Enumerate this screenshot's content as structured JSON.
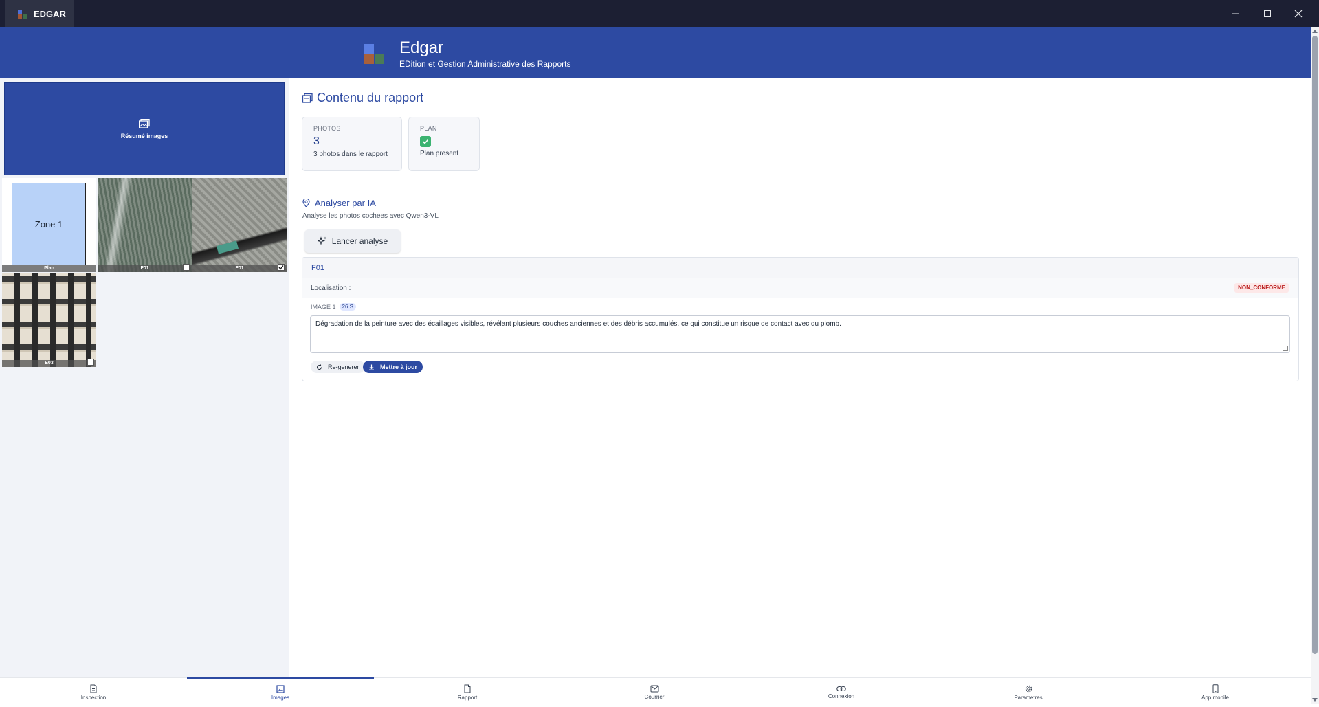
{
  "window": {
    "tab_title": "EDGAR",
    "controls": [
      "minimize-icon",
      "maximize-icon",
      "close-icon"
    ]
  },
  "header": {
    "title": "Edgar",
    "subtitle": "EDition et Gestion Administrative des Rapports",
    "brand_color": "#2d4aa2"
  },
  "left_panel": {
    "summary_button": "Résumé images",
    "thumbnails": [
      {
        "caption": "Plan",
        "kind": "plan",
        "zone_label": "Zone 1"
      },
      {
        "caption": "F01",
        "kind": "photo",
        "checked": false
      },
      {
        "caption": "F01",
        "kind": "photo",
        "checked": true
      },
      {
        "caption": "E03",
        "kind": "photo",
        "checked": false
      }
    ]
  },
  "report": {
    "title": "Contenu du rapport",
    "photos": {
      "label": "PHOTOS",
      "value": "3",
      "sub": "3 photos dans le rapport"
    },
    "plan": {
      "label": "PLAN",
      "sub": "Plan present",
      "present": true
    }
  },
  "ia": {
    "title": "Analyser par IA",
    "subtitle": "Analyse les photos cochees avec Qwen3-VL",
    "launch_label": "Lancer analyse"
  },
  "result": {
    "id": "F01",
    "location_label": "Localisation :",
    "status": "NON_CONFORME",
    "image_label": "IMAGE 1",
    "time": "26 S",
    "description": "Dégradation de la peinture avec des écaillages visibles, révélant plusieurs couches anciennes et des débris accumulés, ce qui constitue un risque de contact avec du plomb.",
    "regen_label": "Re-generer",
    "update_label": "Mettre à jour"
  },
  "nav": {
    "active_index": 1,
    "items": [
      {
        "label": "Inspection",
        "icon": "document-icon"
      },
      {
        "label": "Images",
        "icon": "image-icon"
      },
      {
        "label": "Rapport",
        "icon": "report-icon"
      },
      {
        "label": "Courrier",
        "icon": "mail-icon"
      },
      {
        "label": "Connexion",
        "icon": "link-icon"
      },
      {
        "label": "Parametres",
        "icon": "gear-icon"
      },
      {
        "label": "App mobile",
        "icon": "phone-icon"
      }
    ]
  }
}
